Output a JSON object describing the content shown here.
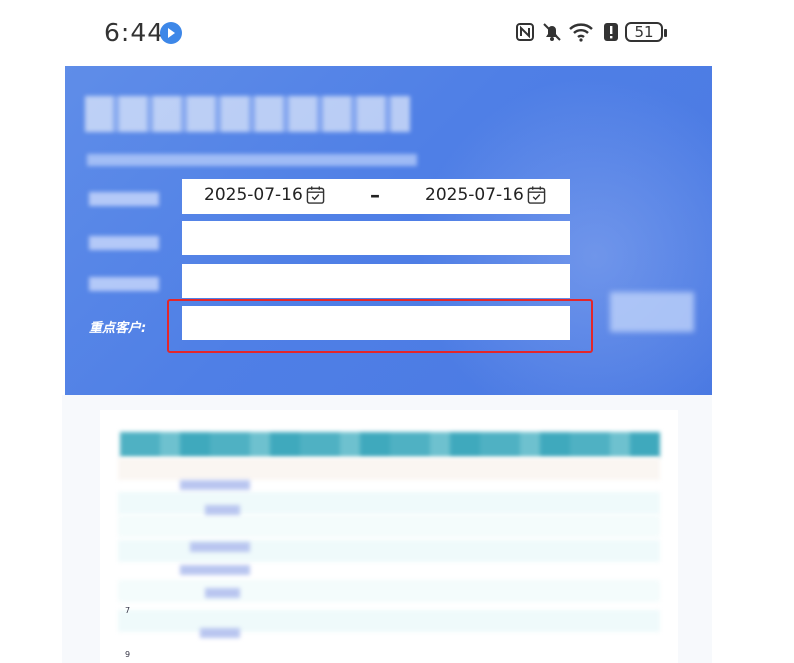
{
  "status_bar": {
    "time": "6:44",
    "battery": "51",
    "icons": [
      "nfc-icon",
      "mute-bell-icon",
      "wifi-icon",
      "alert-icon",
      "battery-icon"
    ]
  },
  "filter": {
    "start_date": "2025-07-16",
    "separator": "–",
    "end_date": "2025-07-16",
    "key_customer_label": "重点客户:",
    "key_customer_value": ""
  },
  "table": {
    "row_numbers": [
      "7",
      "9"
    ]
  },
  "colors": {
    "banner": "#5382e6",
    "highlight": "#e3262a",
    "table_header": "#4fb1c3"
  }
}
